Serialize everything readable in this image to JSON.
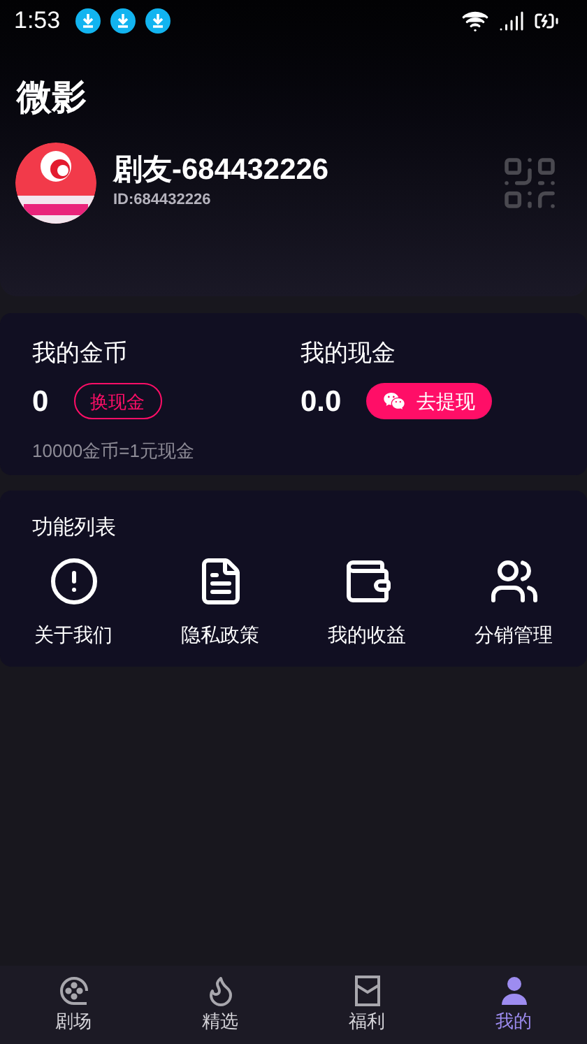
{
  "status_bar": {
    "time": "1:53"
  },
  "app_title": "微影",
  "profile": {
    "name": "剧友-684432226",
    "id": "ID:684432226"
  },
  "wallet": {
    "coins": {
      "label": "我的金币",
      "value": "0",
      "button": "换现金"
    },
    "cash": {
      "label": "我的现金",
      "value": "0.0",
      "button": "去提现"
    },
    "rate": "10000金币=1元现金"
  },
  "features": {
    "title": "功能列表",
    "items": [
      {
        "label": "关于我们",
        "kind": "info"
      },
      {
        "label": "隐私政策",
        "kind": "document"
      },
      {
        "label": "我的收益",
        "kind": "wallet"
      },
      {
        "label": "分销管理",
        "kind": "people"
      }
    ]
  },
  "tab_bar": [
    {
      "label": "剧场",
      "kind": "film",
      "selected": false
    },
    {
      "label": "精选",
      "kind": "flame",
      "selected": false
    },
    {
      "label": "福利",
      "kind": "envelope",
      "selected": false
    },
    {
      "label": "我的",
      "kind": "user",
      "selected": true
    }
  ]
}
